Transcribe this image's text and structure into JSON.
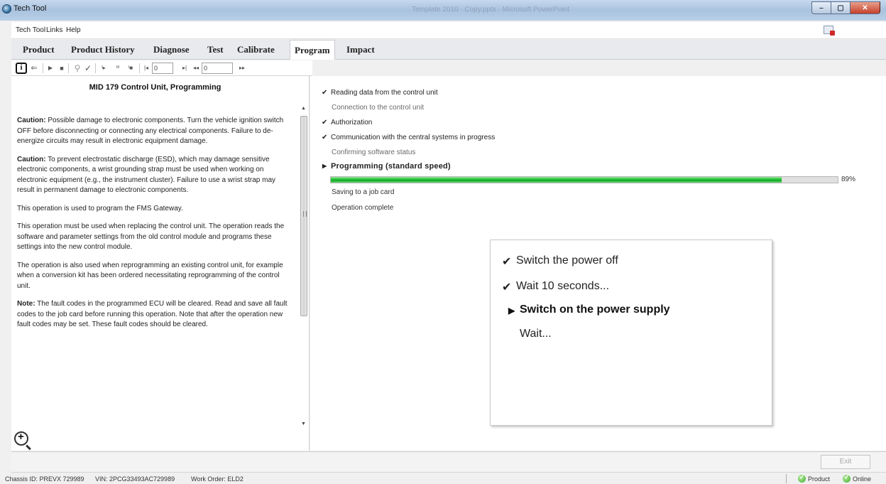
{
  "window": {
    "title": "Tech Tool",
    "doc_title": "Template 2010 · Copy.pptx · Microsoft PowerPoint",
    "buttons": {
      "minimize": "–",
      "maximize": "▢",
      "close": "✕"
    }
  },
  "menu": {
    "items": [
      "Tech Tool",
      "Links",
      "Help"
    ]
  },
  "tabs": [
    "Product",
    "Product History",
    "Diagnose",
    "Test",
    "Calibrate",
    "Program",
    "Impact"
  ],
  "toolbar": {
    "info": "i",
    "back": "⇐",
    "play": "▶",
    "stop": "■",
    "check": "✓",
    "step_start": "ᴵ▸",
    "step_mid": "ᴵᴵᴵ",
    "step_end": "ᴵ■",
    "first": "|◂",
    "prev": "▸|",
    "rew": "◂◂",
    "ffwd": "▸▸",
    "counter1": "0",
    "counter2": "0"
  },
  "left": {
    "title": "MID 179 Control Unit, Programming",
    "caution1_label": "Caution:",
    "caution1_text": " Possible damage to electronic components. Turn the vehicle ignition switch OFF before disconnecting or connecting any electrical components. Failure to de-energize circuits may result in electronic equipment damage.",
    "caution2_label": "Caution:",
    "caution2_text": " To prevent electrostatic discharge (ESD), which may damage sensitive electronic components, a wrist grounding strap must be used when working on electronic equipment (e.g., the instrument cluster). Failure to use a wrist strap may result in permanent damage to electronic components.",
    "para3": "This operation is used to program the FMS Gateway.",
    "para4": "This operation must be used when replacing the control unit. The operation reads the software and parameter settings from the old control module and programs these settings into the new control module.",
    "para5": "The operation is also used when reprogramming an existing control unit, for example when a conversion kit has been ordered necessitating reprogramming of the control unit.",
    "note_label": "Note:",
    "note_text": " The fault codes in the programmed ECU will be cleared. Read and save all fault codes to the job card before running this operation. Note that after the operation new fault codes may be set. These fault codes should be cleared."
  },
  "steps": [
    {
      "label": "Reading data from the control unit",
      "mark": "✔"
    },
    {
      "label": "Connection to the control unit",
      "mark": ""
    },
    {
      "label": "Authorization",
      "mark": "✔"
    },
    {
      "label": "Communication with the central systems in progress",
      "mark": "✔"
    },
    {
      "label": "Confirming software status",
      "mark": ""
    },
    {
      "label": "Programming (standard speed)",
      "mark": "▶"
    },
    {
      "label": "Saving to a job card",
      "mark": ""
    },
    {
      "label": "Operation complete",
      "mark": ""
    }
  ],
  "progress": {
    "value": 0.89,
    "label": "89%"
  },
  "dialog": {
    "items": [
      {
        "label": "Switch the power off",
        "mark": "✔"
      },
      {
        "label": "Wait 10 seconds...",
        "mark": "✔"
      },
      {
        "label": "Switch on the power supply",
        "mark": "▶"
      },
      {
        "label": "Wait...",
        "mark": ""
      }
    ]
  },
  "actions": {
    "exit": "Exit"
  },
  "status": {
    "chassis": "Chassis ID: PREVX 729989",
    "vin": "VIN: 2PCG33493AC729989",
    "work_order": "Work Order: ELD2",
    "product": "Product",
    "online": "Online"
  },
  "colors": {
    "progress": "#12a820",
    "status_ok": "#3aa82a"
  }
}
